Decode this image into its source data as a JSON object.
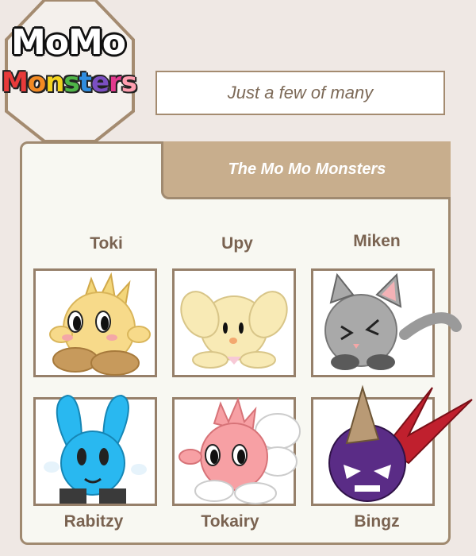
{
  "logo": {
    "line1": "MoMo",
    "line2_letters": [
      "M",
      "o",
      "n",
      "s",
      "t",
      "e",
      "r",
      "s"
    ],
    "line2_colors": [
      "#e83a3a",
      "#f28a23",
      "#f3d31f",
      "#4fb548",
      "#2f8de0",
      "#7b4fc2",
      "#e23a8e",
      "#ff9fb0"
    ]
  },
  "tagline": "Just a few of many",
  "header": {
    "title": "The Mo Mo Monsters"
  },
  "monsters": [
    {
      "name": "Toki",
      "color": "#f7da8a"
    },
    {
      "name": "Upy",
      "color": "#f8eab5"
    },
    {
      "name": "Miken",
      "color": "#a9a9a9"
    },
    {
      "name": "Rabitzy",
      "color": "#29b8f0"
    },
    {
      "name": "Tokairy",
      "color": "#f7a0a4"
    },
    {
      "name": "Bingz",
      "color": "#5a2c86"
    }
  ],
  "colors": {
    "background": "#efe8e4",
    "panel_border": "#a08a70",
    "header_fill": "#c8ae8d",
    "name_text": "#7a6351"
  }
}
